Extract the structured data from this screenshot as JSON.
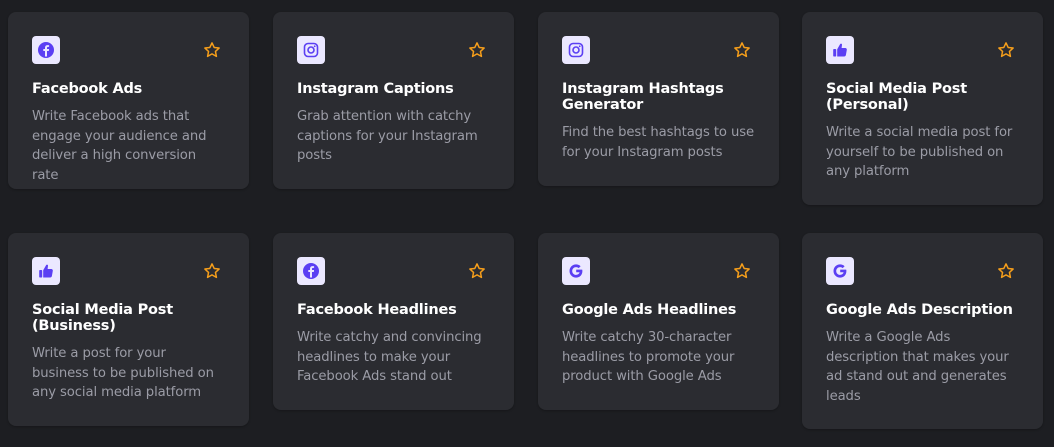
{
  "colors": {
    "background": "#1d1e22",
    "card": "#2b2c31",
    "icon_bg": "#ebe8ff",
    "icon_fg": "#5b3ff3",
    "star": "#f59e1b",
    "title": "#ffffff",
    "description": "#9b9ca6"
  },
  "cards": [
    {
      "icon": "facebook-icon",
      "title": "Facebook Ads",
      "description": "Write Facebook ads that engage your audience and deliver a high conversion rate"
    },
    {
      "icon": "instagram-icon",
      "title": "Instagram Captions",
      "description": "Grab attention with catchy captions for your Instagram posts"
    },
    {
      "icon": "instagram-icon",
      "title": "Instagram Hashtags Generator",
      "description": "Find the best hashtags to use for your Instagram posts"
    },
    {
      "icon": "thumbs-up-icon",
      "title": "Social Media Post (Personal)",
      "description": "Write a social media post for yourself to be published on any platform"
    },
    {
      "icon": "thumbs-up-icon",
      "title": "Social Media Post (Business)",
      "description": "Write a post for your business to be published on any social media platform"
    },
    {
      "icon": "facebook-icon",
      "title": "Facebook Headlines",
      "description": "Write catchy and convincing headlines to make your Facebook Ads stand out"
    },
    {
      "icon": "google-icon",
      "title": "Google Ads Headlines",
      "description": "Write catchy 30-character headlines to promote your product with Google Ads"
    },
    {
      "icon": "google-icon",
      "title": "Google Ads Description",
      "description": "Write a Google Ads description that makes your ad stand out and generates leads"
    }
  ]
}
